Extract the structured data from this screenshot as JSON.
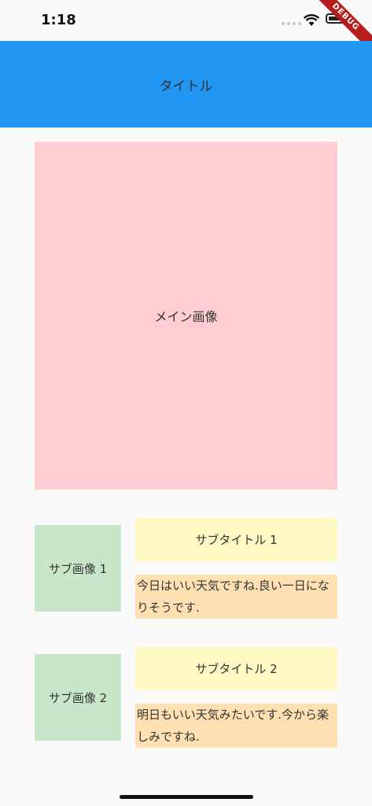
{
  "status_bar": {
    "time": "1:18",
    "debug_label": "DEBUG"
  },
  "app_bar": {
    "title": "タイトル"
  },
  "main_image": {
    "label": "メイン画像"
  },
  "items": [
    {
      "image_label": "サブ画像 1",
      "subtitle": "サブタイトル 1",
      "text": "今日はいい天気ですね.良い一日になりそうです."
    },
    {
      "image_label": "サブ画像 2",
      "subtitle": "サブタイトル 2",
      "text": "明日もいい天気みたいです.今から楽しみですね."
    }
  ]
}
